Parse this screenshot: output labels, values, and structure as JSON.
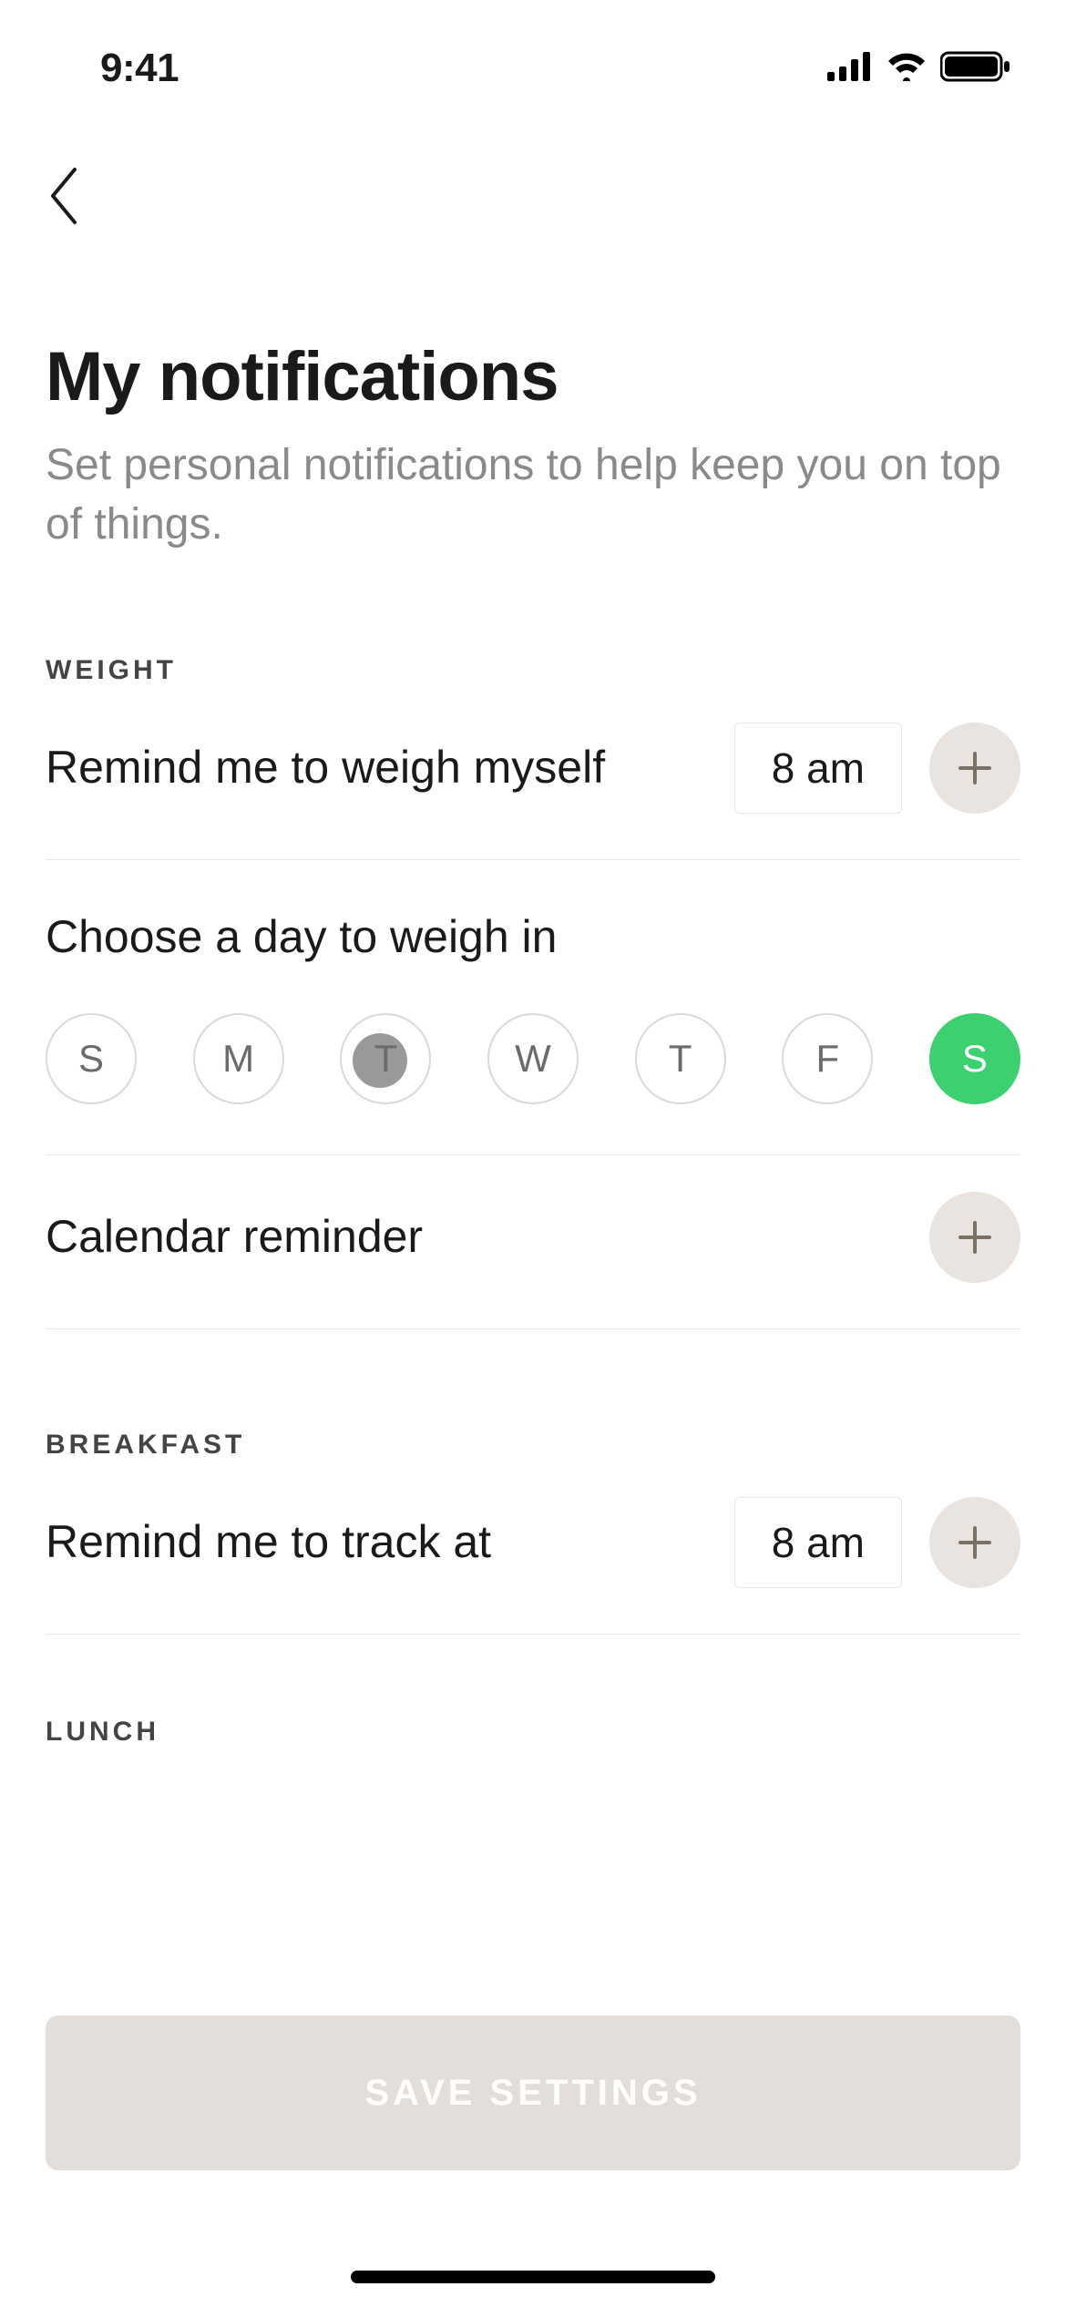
{
  "status": {
    "time": "9:41"
  },
  "header": {
    "title": "My notifications",
    "subtitle": "Set personal notifications to help keep you on top of things."
  },
  "sections": {
    "weight": {
      "label": "WEIGHT",
      "remind_label": "Remind me to weigh myself",
      "remind_time": "8 am",
      "day_title": "Choose a day to weigh in",
      "days": [
        "S",
        "M",
        "T",
        "W",
        "T",
        "F",
        "S"
      ],
      "calendar_label": "Calendar reminder"
    },
    "breakfast": {
      "label": "BREAKFAST",
      "track_label": "Remind me to track at",
      "track_time": "8 am"
    },
    "lunch": {
      "label": "LUNCH"
    }
  },
  "footer": {
    "save_label": "SAVE SETTINGS"
  }
}
